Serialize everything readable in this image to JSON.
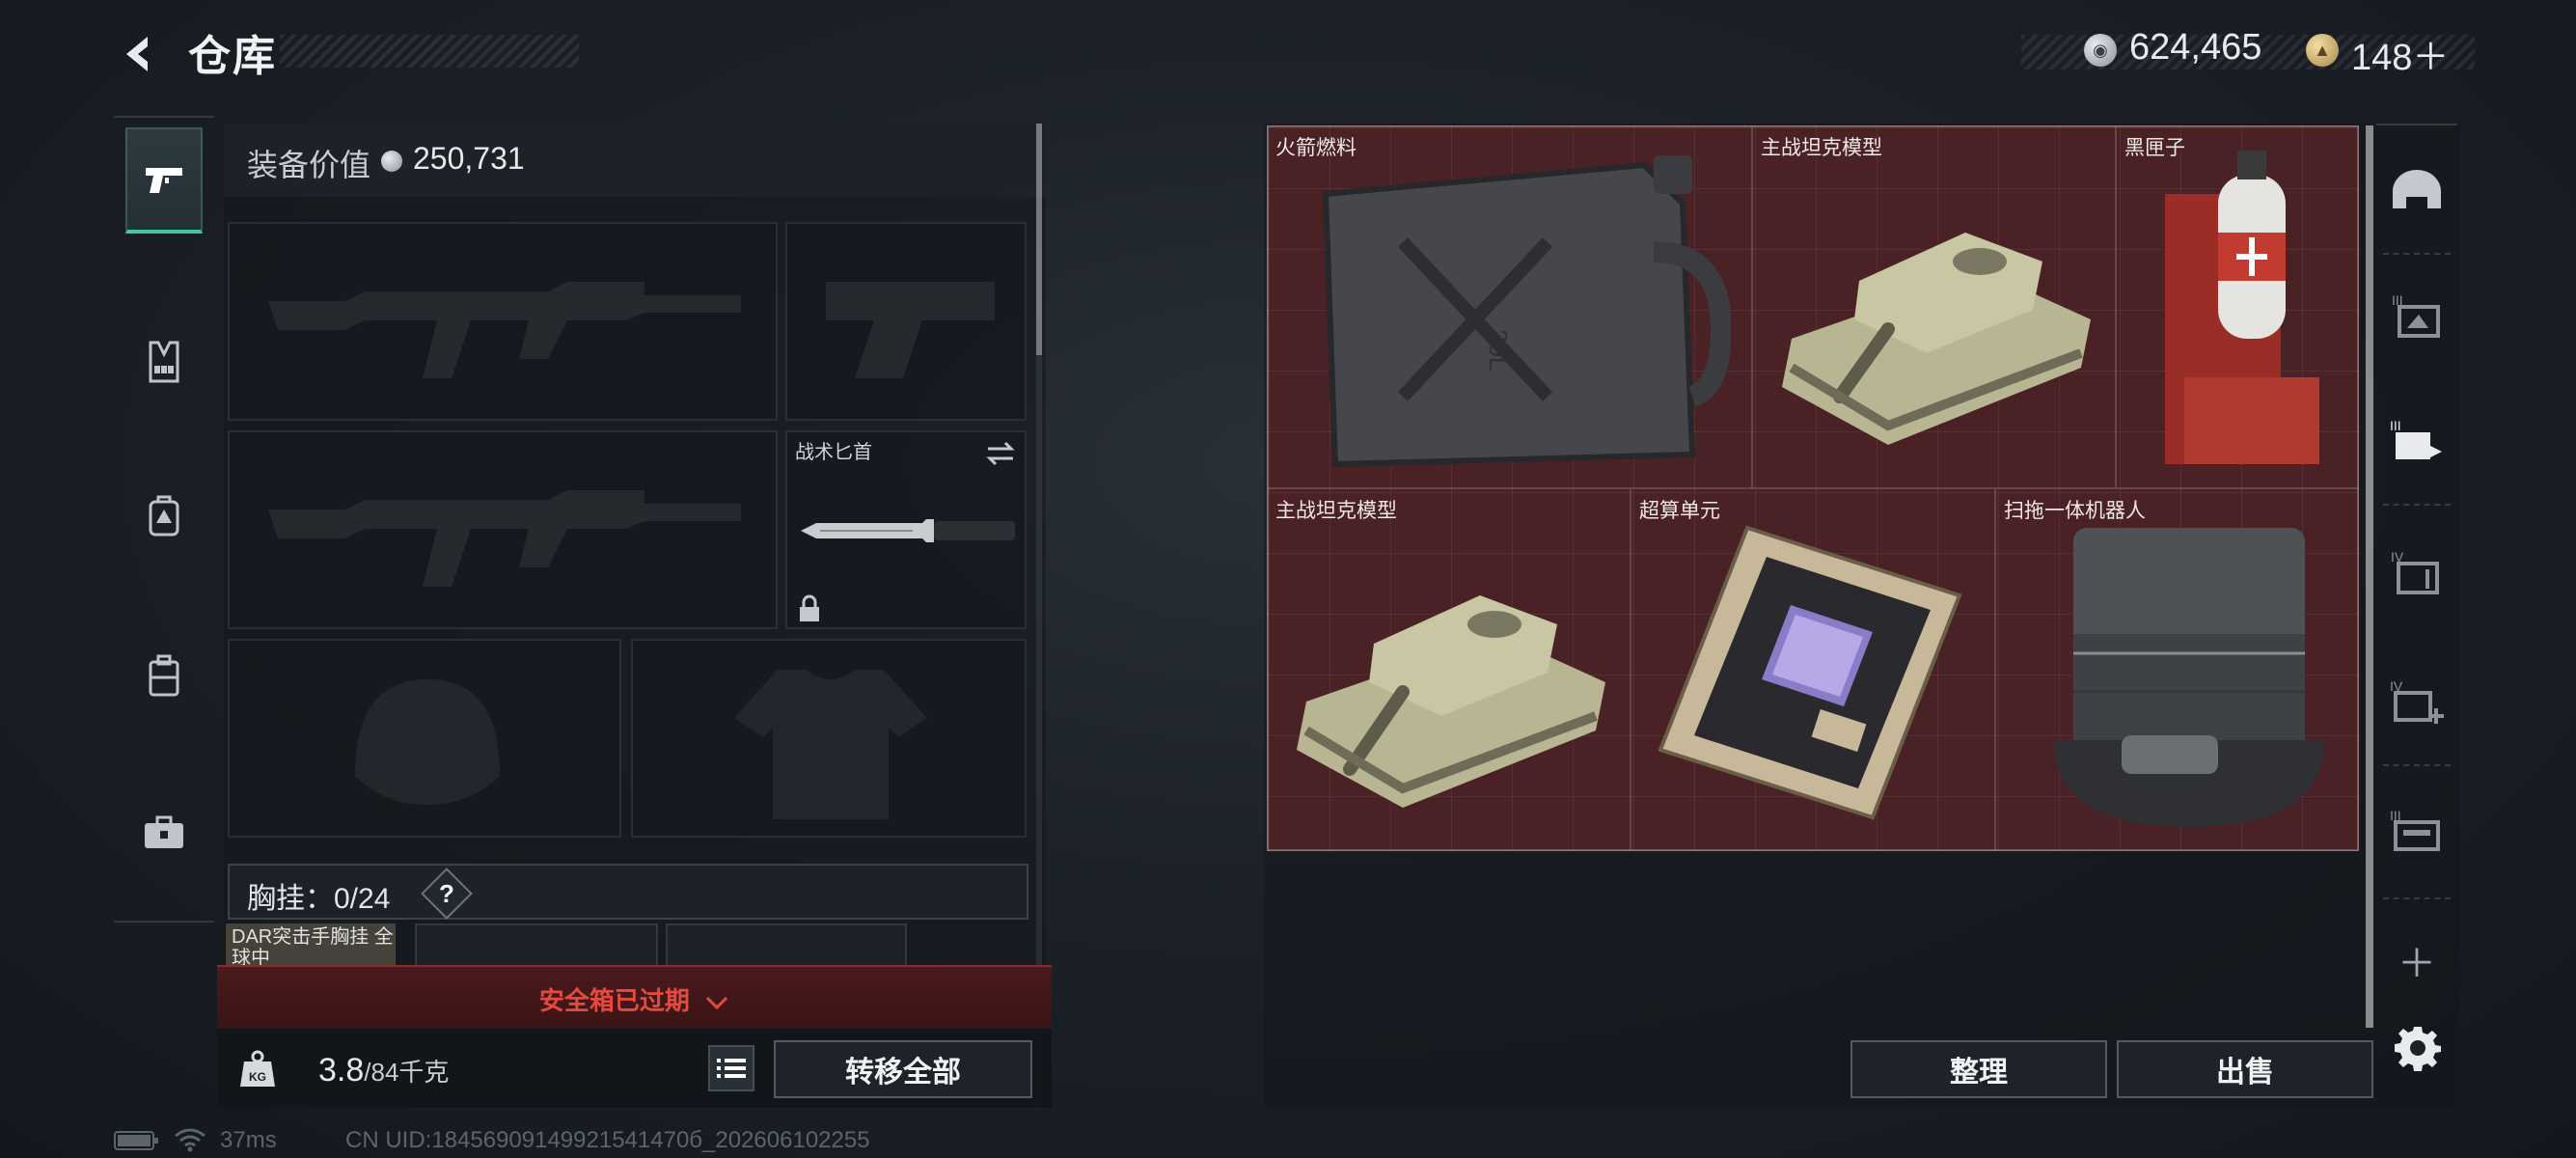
{
  "header": {
    "title": "仓库",
    "money": "624,465",
    "tickets": "148＋"
  },
  "equipment": {
    "value_label": "装备价值",
    "value": "250,731",
    "knife_label": "战术匕首",
    "rig_label": "胸挂：",
    "rig_count": "0/24",
    "rig_help": "?",
    "rig_item_name": "DAR突击手胸挂 全球中",
    "safe_box_status": "安全箱已过期",
    "weight": "3.8",
    "weight_max": "/84千克",
    "transfer_all": "转移全部"
  },
  "storage": {
    "items": [
      {
        "name": "火箭燃料"
      },
      {
        "name": "主战坦克模型"
      },
      {
        "name": "黑匣子"
      },
      {
        "name": "主战坦克模型"
      },
      {
        "name": "超算单元"
      },
      {
        "name": "扫拖一体机器人"
      }
    ],
    "sort_button": "整理",
    "sell_button": "出售",
    "grid_color": "#4a2226",
    "accent": "#3fc8a8"
  },
  "categories": [
    "helmet-icon",
    "tier3-storage-icon",
    "tier3-transfer-icon",
    "tier4-storage-icon",
    "tier4-add-icon",
    "tier3-extra-icon"
  ],
  "status": {
    "ping": "37ms",
    "uid": "CN UID:18456909149921541470б_202606102255"
  }
}
